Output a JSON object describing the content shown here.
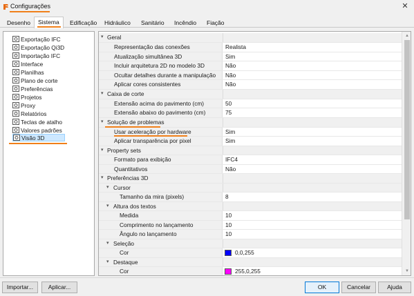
{
  "window": {
    "title": "Configurações",
    "close_icon": "close-icon",
    "accent": "#f07f19"
  },
  "tabs": [
    {
      "label": "Desenho"
    },
    {
      "label": "Sistema"
    },
    {
      "label": "Edificação"
    },
    {
      "label": "Hidráulico"
    },
    {
      "label": "Sanitário"
    },
    {
      "label": "Incêndio"
    },
    {
      "label": "Fiação"
    }
  ],
  "active_tab": "Sistema",
  "tree": [
    {
      "label": "Exportação IFC"
    },
    {
      "label": "Exportação Qi3D"
    },
    {
      "label": "Importação IFC"
    },
    {
      "label": "Interface"
    },
    {
      "label": "Planilhas"
    },
    {
      "label": "Plano de corte"
    },
    {
      "label": "Preferências"
    },
    {
      "label": "Projetos"
    },
    {
      "label": "Proxy"
    },
    {
      "label": "Relatórios"
    },
    {
      "label": "Teclas de atalho"
    },
    {
      "label": "Valores padrões"
    },
    {
      "label": "Visão 3D"
    }
  ],
  "selected_tree_item": "Visão 3D",
  "properties": {
    "geral": {
      "label": "Geral",
      "rows": [
        {
          "name": "Representação das conexões",
          "value": "Realista"
        },
        {
          "name": "Atualização simultânea 3D",
          "value": "Sim"
        },
        {
          "name": "Incluir arquitetura 2D no modelo 3D",
          "value": "Não"
        },
        {
          "name": "Ocultar detalhes durante a manipulação",
          "value": "Não"
        },
        {
          "name": "Aplicar cores consistentes",
          "value": "Não"
        }
      ]
    },
    "caixa_corte": {
      "label": "Caixa de corte",
      "rows": [
        {
          "name": "Extensão acima do pavimento (cm)",
          "value": "50"
        },
        {
          "name": "Extensão abaixo do pavimento (cm)",
          "value": "75"
        }
      ]
    },
    "solucao": {
      "label": "Solução de problemas",
      "rows": [
        {
          "name": "Usar aceleração por hardware",
          "value": "Sim"
        },
        {
          "name": "Aplicar transparência por pixel",
          "value": "Sim"
        }
      ]
    },
    "property_sets": {
      "label": "Property sets",
      "rows": [
        {
          "name": "Formato para exibição",
          "value": "IFC4"
        },
        {
          "name": "Quantitativos",
          "value": "Não"
        }
      ]
    },
    "preferencias_3d": {
      "label": "Preferências 3D",
      "cursor": {
        "label": "Cursor",
        "rows": [
          {
            "name": "Tamanho da mira (pixels)",
            "value": "8"
          }
        ]
      },
      "altura_textos": {
        "label": "Altura dos textos",
        "rows": [
          {
            "name": "Medida",
            "value": "10"
          },
          {
            "name": "Comprimento no lançamento",
            "value": "10"
          },
          {
            "name": "Ângulo no lançamento",
            "value": "10"
          }
        ]
      },
      "selecao": {
        "label": "Seleção",
        "rows": [
          {
            "name": "Cor",
            "value": "0,0,255",
            "swatch": "#0000ff"
          }
        ]
      },
      "destaque": {
        "label": "Destaque",
        "rows": [
          {
            "name": "Cor",
            "value": "255,0,255",
            "swatch": "#ff00ff"
          }
        ]
      }
    }
  },
  "buttons": {
    "importar": "Importar...",
    "aplicar": "Aplicar...",
    "ok": "OK",
    "cancelar": "Cancelar",
    "ajuda": "Ajuda"
  }
}
